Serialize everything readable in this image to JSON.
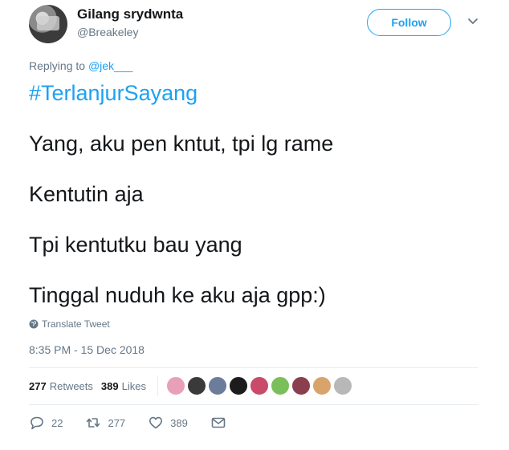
{
  "user": {
    "name": "Gilang srydwnta",
    "handle": "@Breakeley",
    "follow_label": "Follow"
  },
  "reply": {
    "prefix": "Replying to ",
    "mention": "@jek___"
  },
  "tweet": {
    "hashtag": "#TerlanjurSayang",
    "lines": [
      "Yang, aku pen kntut, tpi lg rame",
      "Kentutin aja",
      "Tpi kentutku bau yang",
      "Tinggal nuduh ke aku aja gpp:)"
    ],
    "translate_label": "Translate Tweet",
    "timestamp": "8:35 PM - 15 Dec 2018"
  },
  "stats": {
    "retweets_count": "277",
    "retweets_label": "Retweets",
    "likes_count": "389",
    "likes_label": "Likes",
    "liker_avatar_colors": [
      "#e8a0b8",
      "#3a3a3a",
      "#6b7d9a",
      "#1c1c1c",
      "#c94a6a",
      "#7bbf5a",
      "#8a3f4f",
      "#d9a46b",
      "#b8b8b8"
    ]
  },
  "actions": {
    "reply_count": "22",
    "retweet_count": "277",
    "like_count": "389"
  },
  "colors": {
    "accent": "#1da1f2",
    "muted": "#657786",
    "text": "#14171a"
  }
}
